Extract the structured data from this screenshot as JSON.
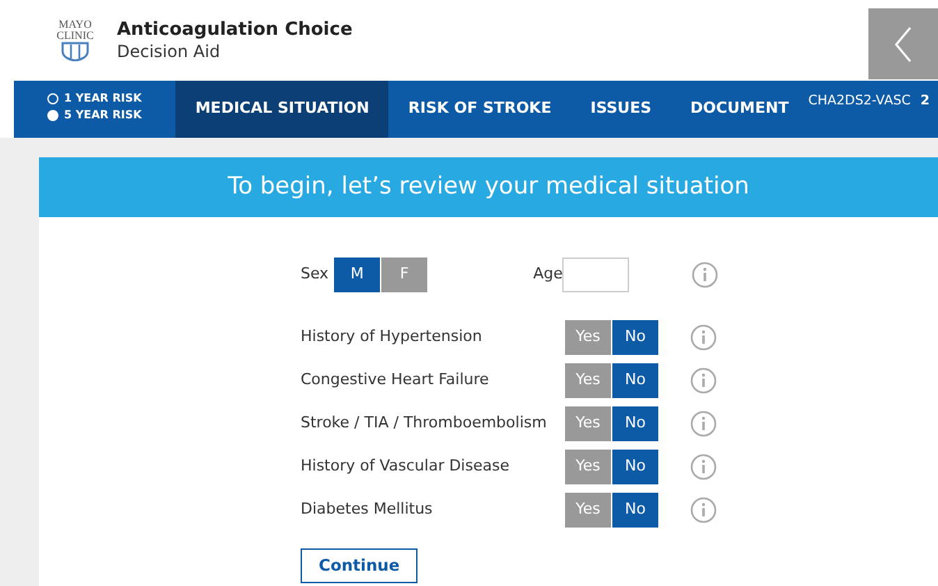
{
  "header": {
    "logo_lines": [
      "MAYO",
      "CLINIC"
    ],
    "title": "Anticoagulation Choice",
    "subtitle": "Decision Aid"
  },
  "nav": {
    "risk_options": [
      {
        "label": "1 YEAR RISK",
        "selected": false
      },
      {
        "label": "5 YEAR RISK",
        "selected": true
      }
    ],
    "tabs": [
      {
        "label": "MEDICAL SITUATION",
        "selected": true
      },
      {
        "label": "RISK OF STROKE",
        "selected": false
      },
      {
        "label": "ISSUES",
        "selected": false
      },
      {
        "label": "DOCUMENT",
        "selected": false
      }
    ],
    "score": {
      "label": "CHA2DS2-VASC",
      "value": "2"
    }
  },
  "banner": "To begin, let’s review your medical situation",
  "form": {
    "sex": {
      "label": "Sex",
      "options": [
        {
          "label": "M",
          "selected": true
        },
        {
          "label": "F",
          "selected": false
        }
      ]
    },
    "age": {
      "label": "Age"
    },
    "questions": [
      {
        "label": "History of Hypertension",
        "options": [
          {
            "label": "Yes",
            "selected": false
          },
          {
            "label": "No",
            "selected": true
          }
        ]
      },
      {
        "label": "Congestive Heart Failure",
        "options": [
          {
            "label": "Yes",
            "selected": false
          },
          {
            "label": "No",
            "selected": true
          }
        ]
      },
      {
        "label": "Stroke / TIA / Thromboembolism",
        "options": [
          {
            "label": "Yes",
            "selected": false
          },
          {
            "label": "No",
            "selected": true
          }
        ]
      },
      {
        "label": "History of Vascular Disease",
        "options": [
          {
            "label": "Yes",
            "selected": false
          },
          {
            "label": "No",
            "selected": true
          }
        ]
      },
      {
        "label": "Diabetes Mellitus",
        "options": [
          {
            "label": "Yes",
            "selected": false
          },
          {
            "label": "No",
            "selected": true
          }
        ]
      }
    ],
    "continue": "Continue"
  }
}
